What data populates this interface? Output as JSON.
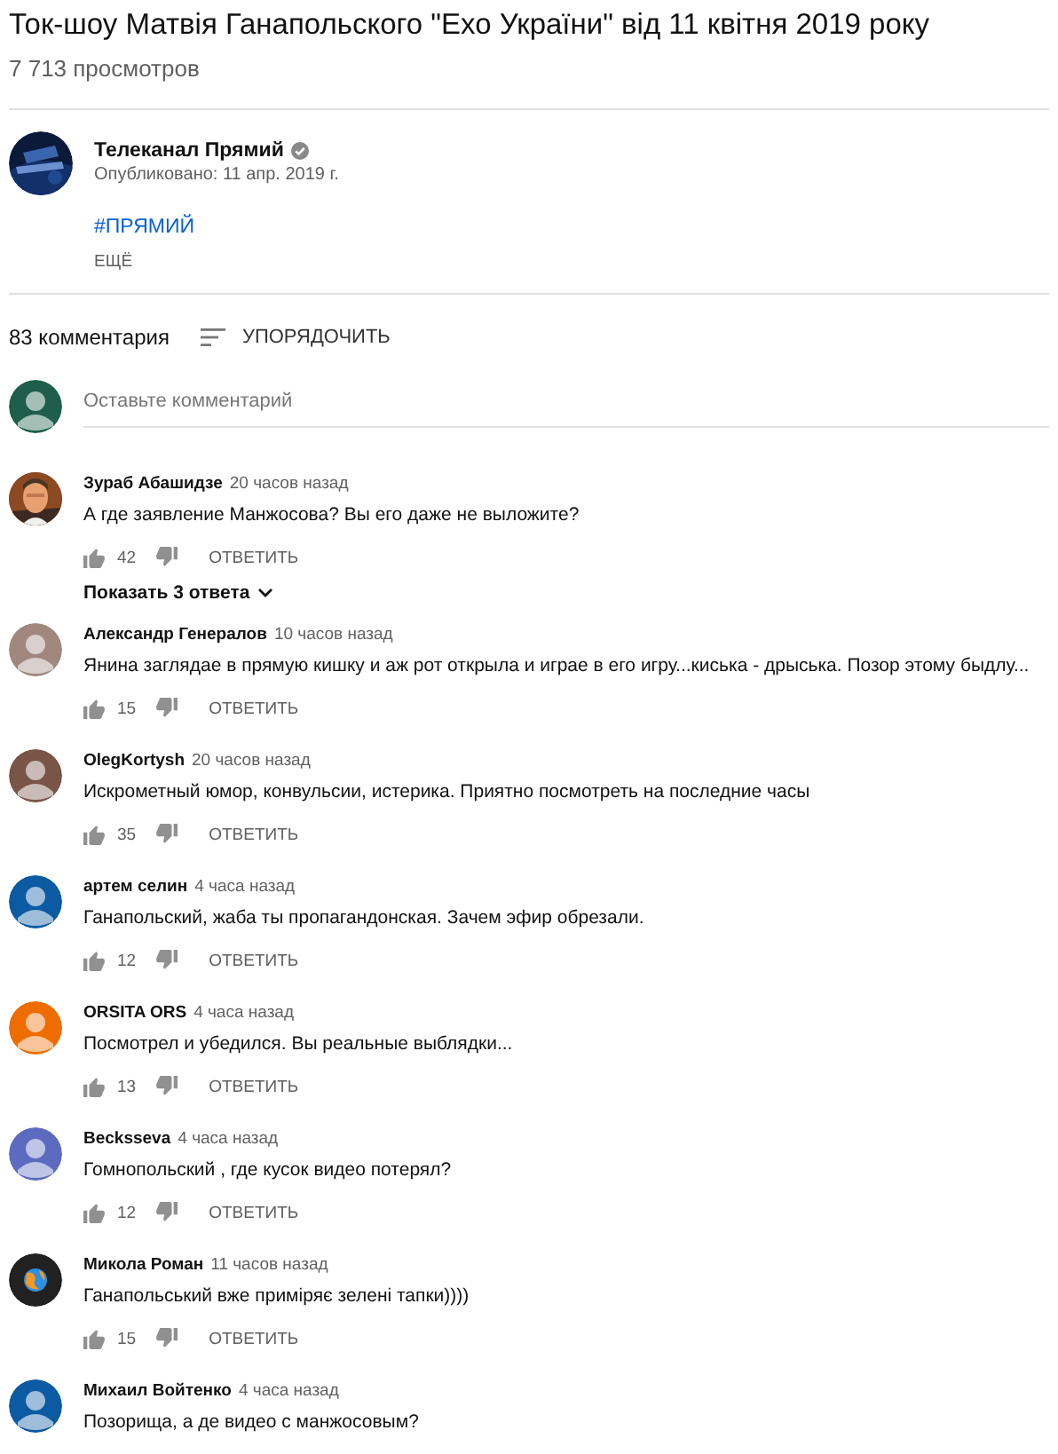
{
  "video": {
    "title": "Ток-шоу Матвія Ганапольского \"Ехо України\" від 11 квітня 2019 року",
    "views": "7 713 просмотров"
  },
  "channel": {
    "name": "Телеканал Прямий",
    "verified": true,
    "published": "Опубликовано: 11 апр. 2019 г.",
    "hashtag": "#ПРЯМИЙ",
    "more": "ЕЩЁ"
  },
  "comments_header": {
    "count": "83 комментария",
    "sort": "УПОРЯДОЧИТЬ"
  },
  "new_comment": {
    "placeholder": "Оставьте комментарий"
  },
  "comments": [
    {
      "author": "Зураб Абашидзе",
      "time": "20 часов назад",
      "text": "А где заявление Манжосова? Вы его даже не выложите?",
      "likes": "42",
      "reply": "ОТВЕТИТЬ",
      "replies": "Показать 3 ответа"
    },
    {
      "author": "Александр Генералов",
      "time": "10 часов назад",
      "text": "Янина заглядае в прямую кишку и аж рот открыла и играе в его игру...киська - дрыська. Позор этому быдлу...",
      "likes": "15",
      "reply": "ОТВЕТИТЬ",
      "avatar": {
        "kind": "default",
        "color": "#a1887f"
      }
    },
    {
      "author": "OlegKortysh",
      "time": "20 часов назад",
      "text": "Искрометный юмор, конвульсии, истерика. Приятно посмотреть на последние часы",
      "likes": "35",
      "reply": "ОТВЕТИТЬ",
      "avatar": {
        "kind": "default",
        "color": "#795548"
      }
    },
    {
      "author": "артем селин",
      "time": "4 часа назад",
      "text": "Ганапольский, жаба ты пропагандонская. Зачем эфир обрезали.",
      "likes": "12",
      "reply": "ОТВЕТИТЬ",
      "avatar": {
        "kind": "default",
        "color": "#0b5aa2"
      }
    },
    {
      "author": "ORSITA ORS",
      "time": "4 часа назад",
      "text": "Посмотрел и убедился. Вы реальные выблядки...",
      "likes": "13",
      "reply": "ОТВЕТИТЬ",
      "avatar": {
        "kind": "default",
        "color": "#ef6c00"
      }
    },
    {
      "author": "Becksseva",
      "time": "4 часа назад",
      "text": "Гомнопольский ,  где кусок видео потерял?",
      "likes": "12",
      "reply": "ОТВЕТИТЬ",
      "avatar": {
        "kind": "default",
        "color": "#5c6bc0"
      }
    },
    {
      "author": "Микола Роман",
      "time": "11 часов назад",
      "text": "Ганапольський вже приміряє зелені тапки))))",
      "likes": "15",
      "reply": "ОТВЕТИТЬ",
      "avatar": {
        "kind": "globe",
        "color": "#212121"
      }
    },
    {
      "author": "Михаил Войтенко",
      "time": "4 часа назад",
      "text": "Позорища, а де видео с манжосовым?",
      "avatar": {
        "kind": "default",
        "color": "#0b5aa2"
      }
    }
  ]
}
